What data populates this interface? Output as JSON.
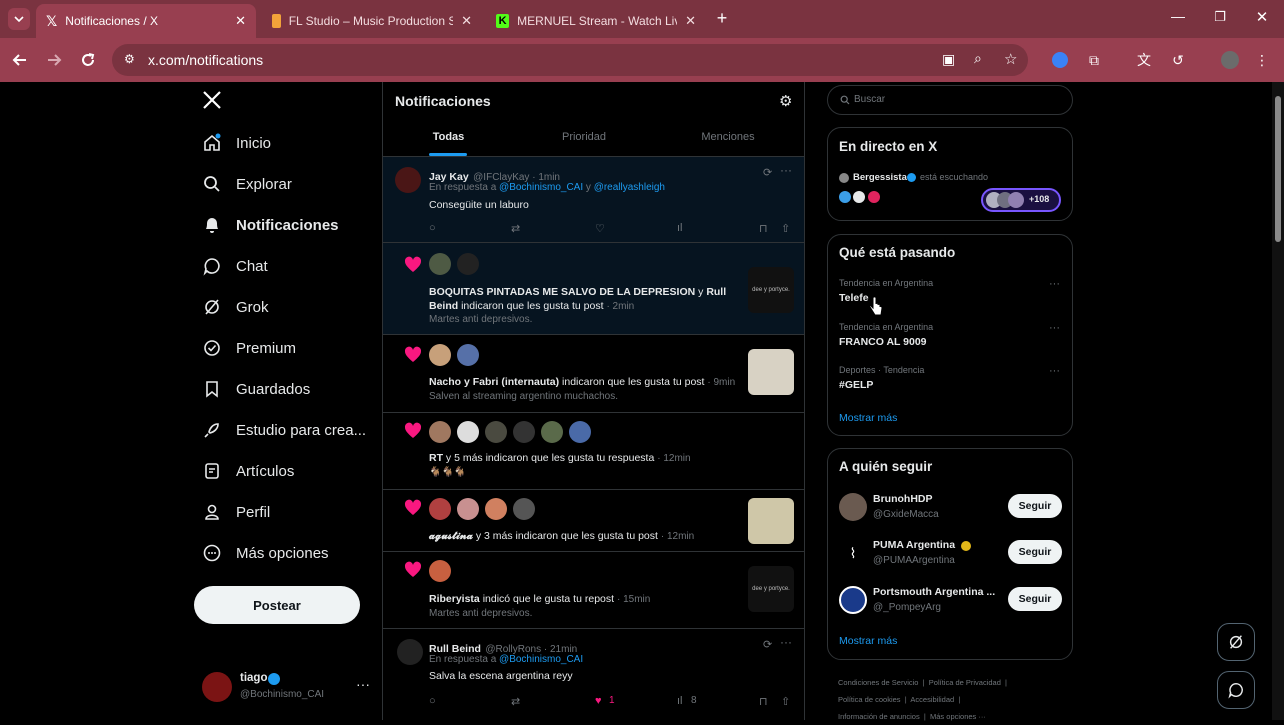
{
  "browser": {
    "tabs": [
      {
        "title": "Notificaciones / X",
        "active": true
      },
      {
        "title": "FL Studio – Music Production S...",
        "active": false
      },
      {
        "title": "MERNUEL Stream - Watch Live",
        "active": false
      }
    ],
    "url": "x.com/notifications"
  },
  "nav": {
    "items": [
      {
        "label": "Inicio"
      },
      {
        "label": "Explorar"
      },
      {
        "label": "Notificaciones"
      },
      {
        "label": "Chat"
      },
      {
        "label": "Grok"
      },
      {
        "label": "Premium"
      },
      {
        "label": "Guardados"
      },
      {
        "label": "Estudio para crea..."
      },
      {
        "label": "Artículos"
      },
      {
        "label": "Perfil"
      },
      {
        "label": "Más opciones"
      }
    ],
    "post_label": "Postear",
    "user": {
      "name": "tiago",
      "handle": "@Bochinismo_CAI"
    }
  },
  "center": {
    "title": "Notificaciones",
    "tabs": [
      "Todas",
      "Prioridad",
      "Menciones"
    ],
    "n1": {
      "name": "Jay Kay",
      "handle": "@IFClayKay · 1min",
      "reply_prefix": "En respuesta a",
      "mention1": "@Bochinismo_CAI",
      "y": "y",
      "mention2": "@reallyashleigh",
      "text": "Consegüite un laburo"
    },
    "n2": {
      "names": "BOQUITAS PINTADAS ME SALVO DE LA DEPRESION",
      "and": "y",
      "names2": "Rull Beind",
      "action": "indicaron que les gusta tu post",
      "time": "· 2min",
      "preview": "Martes anti depresivos.",
      "thumb_text": "dee y portyce."
    },
    "n3": {
      "names": "Nacho y Fabri (internauta)",
      "action": "indicaron que les gusta tu post",
      "time": "· 9min",
      "preview": "Salven al streaming argentino muchachos."
    },
    "n4": {
      "names": "RT",
      "action": "y 5 más indicaron que les gusta tu respuesta",
      "time": "· 12min",
      "preview": "🐐🐐🐐"
    },
    "n5": {
      "names": "𝓪𝓰𝓾𝓼𝓽𝓲𝓷𝓪",
      "action": "y 3 más indicaron que les gusta tu post",
      "time": "· 12min"
    },
    "n6": {
      "names": "Riberyista",
      "action": "indicó que le gusta tu repost",
      "time": "· 15min",
      "preview": "Martes anti depresivos.",
      "thumb_text": "dee y portyce."
    },
    "n7": {
      "name": "Rull Beind",
      "handle": "@RollyRons · 21min",
      "reply_prefix": "En respuesta a",
      "mention1": "@Bochinismo_CAI",
      "text": "Salva la escena argentina reyy",
      "likes": "1",
      "views": "8"
    }
  },
  "right": {
    "search_placeholder": "Buscar",
    "live": {
      "title": "En directo en X",
      "user": "Bergessista",
      "status": "está escuchando",
      "count": "+108"
    },
    "trends": {
      "title": "Qué está pasando",
      "items": [
        {
          "context": "Tendencia en Argentina",
          "name": "Telefe"
        },
        {
          "context": "Tendencia en Argentina",
          "name": "FRANCO AL 9009"
        },
        {
          "context": "Deportes · Tendencia",
          "name": "#GELP"
        }
      ],
      "more": "Mostrar más"
    },
    "follow": {
      "title": "A quién seguir",
      "items": [
        {
          "name": "BrunohHDP",
          "handle": "@GxideMacca"
        },
        {
          "name": "PUMA Argentina",
          "handle": "@PUMAArgentina"
        },
        {
          "name": "Portsmouth Argentina ...",
          "handle": "@_PompeyArg"
        }
      ],
      "button": "Seguir",
      "more": "Mostrar más"
    },
    "footer": {
      "l1": [
        "Condiciones de Servicio",
        "Política de Privacidad"
      ],
      "l2": [
        "Política de cookies",
        "Accesibilidad"
      ],
      "l3": [
        "Información de anuncios",
        "Más opciones ···"
      ]
    }
  },
  "colors": {
    "accent": "#1d9bf0",
    "like": "#f91880",
    "tabbar": "#7a3340",
    "toolbar": "#983f50"
  }
}
